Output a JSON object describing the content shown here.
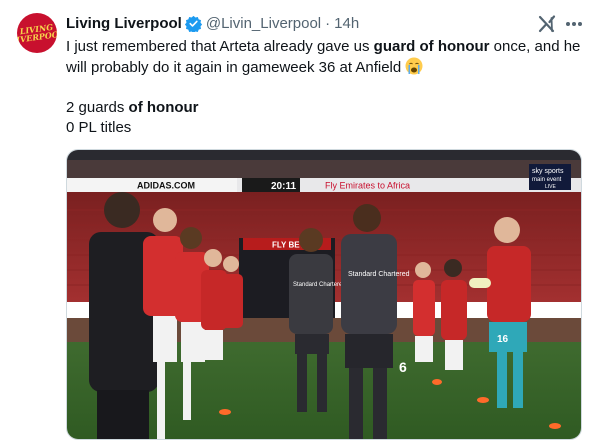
{
  "account": {
    "display_name": "Living Liverpool",
    "handle": "@Livin_Liverpool",
    "separator": "·",
    "time": "14h",
    "avatar_text_top": "LIVING",
    "avatar_text_bottom": "LIVERPOOL",
    "verified_color": "#1d9bf0",
    "brand_color": "#c8102e"
  },
  "tweet": {
    "line1_pre": "I just remembered that Arteta already gave us ",
    "line1_bold": "guard of honour",
    "line1_post": " once, and he will probably do it again in gameweek 36 at Anfield",
    "emoji": "crying-face-emoji",
    "line3_pre": "2 guards ",
    "line3_bold": "of honour",
    "line4": "0 PL titles"
  },
  "icons": {
    "grok": "grok-icon",
    "more": "more-options-icon"
  },
  "media": {
    "ad_board_left": "ADIDAS.COM",
    "scoreboard_time": "20:11",
    "ad_board_right": "Fly Emirates to Africa",
    "broadcaster_top": "sky sports",
    "broadcaster_bottom": "main event",
    "broadcaster_live": "LIVE",
    "tunnel_banner": "FLY BETTER",
    "shirt_sponsor": "Standard Chartered",
    "player_number_front": "6",
    "player_number_keeper": "16"
  }
}
